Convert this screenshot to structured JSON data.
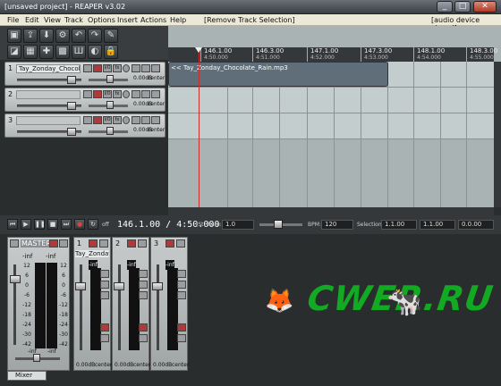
{
  "window": {
    "title": "[unsaved project] - REAPER v3.02",
    "minimize": "_",
    "maximize": "□",
    "close": "✕"
  },
  "menu": {
    "items": [
      "File",
      "Edit",
      "View",
      "Track",
      "Options",
      "Insert",
      "Actions",
      "Help"
    ],
    "last_action": "[Remove Track Selection]",
    "audio_status": "[audio device closed]"
  },
  "toolbar": {
    "buttons": [
      {
        "name": "new-project",
        "glyph": "▣"
      },
      {
        "name": "open-project",
        "glyph": "⇪"
      },
      {
        "name": "save-project",
        "glyph": "⬇"
      },
      {
        "name": "project-settings",
        "glyph": "⚙"
      },
      {
        "name": "undo",
        "glyph": "↶"
      },
      {
        "name": "redo",
        "glyph": "↷"
      },
      {
        "name": "metronome",
        "glyph": "✎"
      },
      {
        "name": "grid",
        "glyph": "◪"
      },
      {
        "name": "snap",
        "glyph": "▦"
      },
      {
        "name": "ripple",
        "glyph": "✚"
      },
      {
        "name": "auto-crossfade",
        "glyph": "▩"
      },
      {
        "name": "envelopes",
        "glyph": "Ш"
      },
      {
        "name": "item-lock",
        "glyph": "◐"
      },
      {
        "name": "lock",
        "glyph": "🔒"
      }
    ]
  },
  "tracks": [
    {
      "number": "1",
      "name": "Tay_Zonday_Chocola",
      "volume": "0.00dB",
      "pan": "center"
    },
    {
      "number": "2",
      "name": "",
      "volume": "0.00dB",
      "pan": "center"
    },
    {
      "number": "3",
      "name": "",
      "volume": "0.00dB",
      "pan": "center"
    }
  ],
  "track_buttons": {
    "io": "I/O",
    "fx": "fx"
  },
  "ruler": [
    {
      "bar": "146.1.00",
      "time": "4:50.000"
    },
    {
      "bar": "146.3.00",
      "time": "4:51.000"
    },
    {
      "bar": "147.1.00",
      "time": "4:52.000"
    },
    {
      "bar": "147.3.00",
      "time": "4:53.000"
    },
    {
      "bar": "148.1.00",
      "time": "4:54.000"
    },
    {
      "bar": "148.3.00",
      "time": "4:55.000"
    }
  ],
  "media_item": {
    "label": "<< Tay_Zonday_Chocolate_Rain.mp3"
  },
  "transport": {
    "position": "146.1.00 / 4:50.000",
    "position_suffix": "[St",
    "off_label": "off",
    "rate_label": "Rate:",
    "rate_value": "1.0",
    "bpm_label": "BPM:",
    "bpm_value": "120",
    "selection_label": "Selection:",
    "sel_start": "1.1.00",
    "sel_end": "1.1.00",
    "sel_length": "0.0.00"
  },
  "mixer": {
    "master_label": "MASTER",
    "master_peak_left": "-inf",
    "master_peak_right": "-inf",
    "master_volume": "0.00dB",
    "scale": [
      "12",
      "6",
      "0",
      "-6",
      "-12",
      "-18",
      "-24",
      "-30",
      "-42",
      "-54"
    ],
    "master_rms": "-inf",
    "strips": [
      {
        "number": "1",
        "name": "Tay_Zonday_",
        "peak": "-inf",
        "volume": "0.00dB",
        "pan": "center"
      },
      {
        "number": "2",
        "name": "",
        "peak": "-inf",
        "volume": "0.00dB",
        "pan": "center"
      },
      {
        "number": "3",
        "name": "",
        "peak": "-inf",
        "volume": "0.00dB",
        "pan": "center"
      }
    ],
    "tab_label": "Mixer"
  },
  "watermark": {
    "text": "CWER.RU"
  }
}
